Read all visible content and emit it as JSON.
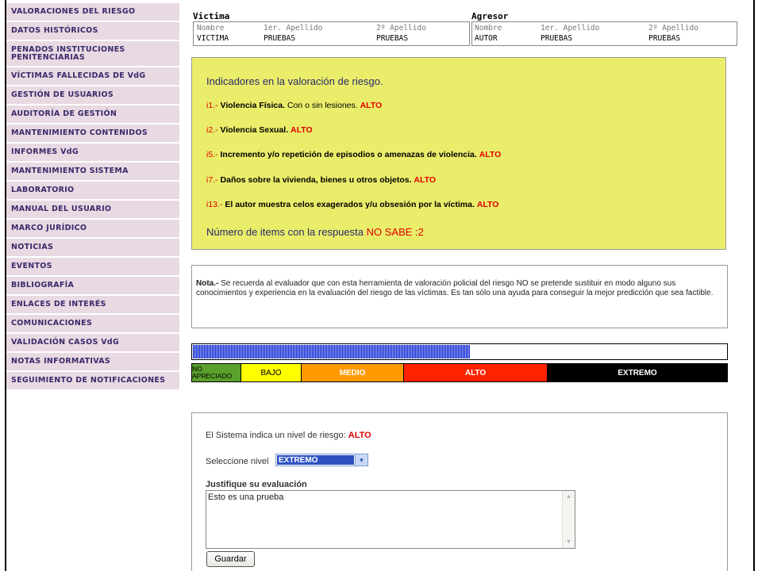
{
  "sidebar": {
    "items": [
      {
        "label": "VALORACIONES DEL RIESGO"
      },
      {
        "label": "DATOS HISTÓRICOS"
      },
      {
        "label": "PENADOS INSTITUCIONES PENITENCIARIAS"
      },
      {
        "label": "VÍCTIMAS FALLECIDAS DE VdG"
      },
      {
        "label": "GESTIÓN DE USUARIOS"
      },
      {
        "label": "AUDITORÍA DE GESTIÓN"
      },
      {
        "label": "MANTENIMIENTO CONTENIDOS"
      },
      {
        "label": "INFORMES VdG"
      },
      {
        "label": "MANTENIMIENTO SISTEMA"
      },
      {
        "label": "LABORATORIO"
      },
      {
        "label": "MANUAL DEL USUARIO"
      },
      {
        "label": "MARCO JURÍDICO"
      },
      {
        "label": "NOTICIAS"
      },
      {
        "label": "EVENTOS"
      },
      {
        "label": "BIBLIOGRAFÍA"
      },
      {
        "label": "ENLACES DE INTERÉS"
      },
      {
        "label": "COMUNICACIONES"
      },
      {
        "label": "VALIDACIÓN CASOS VdG"
      },
      {
        "label": "NOTAS INFORMATIVAS"
      },
      {
        "label": "SEGUIMIENTO DE NOTIFICACIONES"
      }
    ]
  },
  "victima": {
    "title": "Victima",
    "col_nombre": "Nombre",
    "col_ap1": "1er. Apellido",
    "col_ap2": "2º Apellido",
    "nombre": "VICTIMA",
    "ap1": "PRUEBAS",
    "ap2": "PRUEBAS"
  },
  "agresor": {
    "title": "Agresor",
    "col_nombre": "Nombre",
    "col_ap1": "1er. Apellido",
    "col_ap2": "2º Apellido",
    "nombre": "AUTOR",
    "ap1": "PRUEBAS",
    "ap2": "PRUEBAS"
  },
  "indicadores": {
    "heading": "Indicadores en la valoración de riesgo.",
    "items": [
      {
        "code": "i1.-",
        "text": "Violencia Física.",
        "extra": " Con o sin lesiones.",
        "level": "ALTO"
      },
      {
        "code": "i2.-",
        "text": "Violencia Sexual.",
        "extra": "",
        "level": "ALTO"
      },
      {
        "code": "i5.-",
        "text": "Incremento y/o repetición de episodios o amenazas de violencia.",
        "extra": "",
        "level": "ALTO"
      },
      {
        "code": "i7.-",
        "text": "Daños sobre la vivienda, bienes u otros objetos.",
        "extra": "",
        "level": "ALTO"
      },
      {
        "code": "i13.-",
        "text": "El autor muestra celos exagerados y/u obsesión por la víctima.",
        "extra": "",
        "level": "ALTO"
      }
    ],
    "count_label": "Número de items con la respuesta ",
    "count_value": "NO SABE :2"
  },
  "nota": {
    "label": "Nota.-",
    "text": " Se recuerda al evaluador que con esta herramienta de valoración policial del riesgo NO se pretende sustituir en modo alguno sus conocimientos y experiencia en la evaluación del riesgo de las víctimas. Es tan sólo una ayuda para conseguir la mejor predicción que sea factible."
  },
  "risk_meter": {
    "progress_fraction": 0.52,
    "levels": [
      {
        "label": "NO APRECIADO",
        "color": "#5aa02c"
      },
      {
        "label": "BAJO",
        "color": "#ffff00"
      },
      {
        "label": "MEDIO",
        "color": "#ff9900"
      },
      {
        "label": "ALTO",
        "color": "#ff2200"
      },
      {
        "label": "EXTREMO",
        "color": "#000000"
      }
    ]
  },
  "evaluacion": {
    "system_text": "El Sistema indica un nivel de riesgo: ",
    "system_level": "ALTO",
    "select_label": "Seleccione nivel",
    "selected_level": "EXTREMO",
    "justify_label": "Justifique su evaluación",
    "justify_value": "Esto es una prueba",
    "save_label": "Guardar"
  },
  "colors": {
    "accent_red": "#e00000",
    "panel_yellow": "#eaed6a",
    "sidebar_bg": "#e8d9e3"
  }
}
